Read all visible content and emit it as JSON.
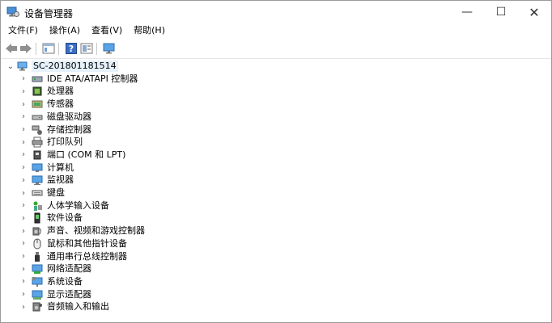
{
  "window": {
    "title": "设备管理器",
    "min": "—",
    "max": "☐",
    "close": "✕"
  },
  "menu": [
    "文件(F)",
    "操作(A)",
    "查看(V)",
    "帮助(H)"
  ],
  "toolbar": [
    "back-icon",
    "forward-icon",
    "properties-icon",
    "help-icon",
    "view-icon",
    "monitor-icon"
  ],
  "tree": {
    "root": "SC-201801181514",
    "items": [
      {
        "label": "IDE ATA/ATAPI 控制器",
        "icon": "ide-controller-icon"
      },
      {
        "label": "处理器",
        "icon": "processor-icon"
      },
      {
        "label": "传感器",
        "icon": "sensor-icon"
      },
      {
        "label": "磁盘驱动器",
        "icon": "disk-drive-icon"
      },
      {
        "label": "存储控制器",
        "icon": "storage-controller-icon"
      },
      {
        "label": "打印队列",
        "icon": "printer-icon"
      },
      {
        "label": "端口 (COM 和 LPT)",
        "icon": "port-icon"
      },
      {
        "label": "计算机",
        "icon": "computer-icon"
      },
      {
        "label": "监视器",
        "icon": "monitor-icon"
      },
      {
        "label": "键盘",
        "icon": "keyboard-icon"
      },
      {
        "label": "人体学输入设备",
        "icon": "hid-icon"
      },
      {
        "label": "软件设备",
        "icon": "software-device-icon"
      },
      {
        "label": "声音、视频和游戏控制器",
        "icon": "sound-icon"
      },
      {
        "label": "鼠标和其他指针设备",
        "icon": "mouse-icon"
      },
      {
        "label": "通用串行总线控制器",
        "icon": "usb-icon"
      },
      {
        "label": "网络适配器",
        "icon": "network-adapter-icon"
      },
      {
        "label": "系统设备",
        "icon": "system-device-icon"
      },
      {
        "label": "显示适配器",
        "icon": "display-adapter-icon"
      },
      {
        "label": "音频输入和输出",
        "icon": "audio-io-icon"
      }
    ]
  },
  "colors": {
    "selection": "#e5f1fb",
    "accent": "#1a6fc9"
  }
}
